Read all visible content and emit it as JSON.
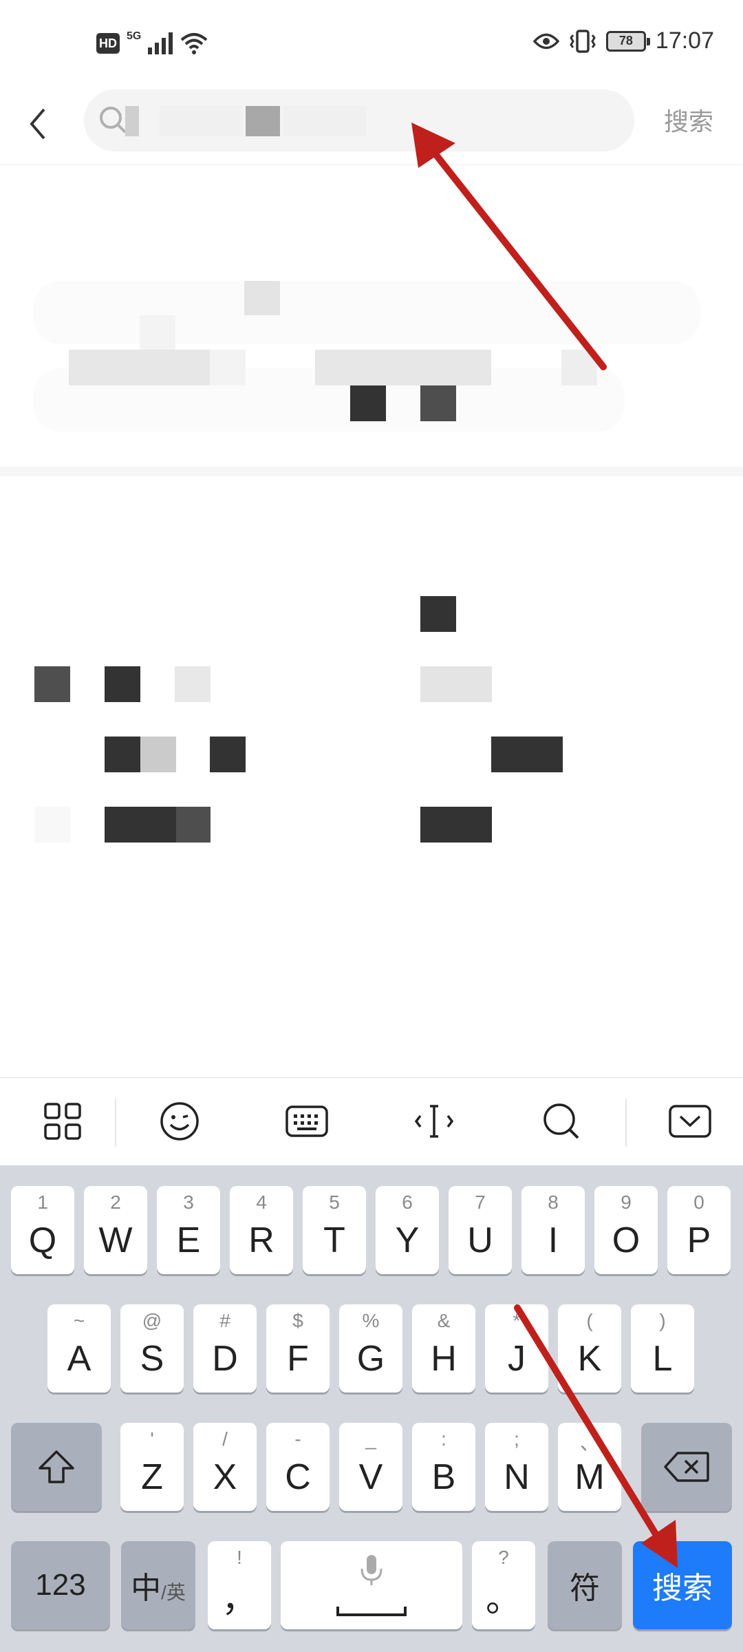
{
  "status_bar": {
    "hd": "HD",
    "network": "5G",
    "battery": "78",
    "time": "17:07"
  },
  "header": {
    "search_placeholder": "",
    "search_button": "搜索"
  },
  "toolbar": {
    "icons": [
      "apps-grid-icon",
      "emoji-icon",
      "keyboard-icon",
      "cursor-icon",
      "search-icon",
      "collapse-keyboard-icon"
    ]
  },
  "keyboard": {
    "row1": [
      {
        "hint": "1",
        "key": "Q"
      },
      {
        "hint": "2",
        "key": "W"
      },
      {
        "hint": "3",
        "key": "E"
      },
      {
        "hint": "4",
        "key": "R"
      },
      {
        "hint": "5",
        "key": "T"
      },
      {
        "hint": "6",
        "key": "Y"
      },
      {
        "hint": "7",
        "key": "U"
      },
      {
        "hint": "8",
        "key": "I"
      },
      {
        "hint": "9",
        "key": "O"
      },
      {
        "hint": "0",
        "key": "P"
      }
    ],
    "row2": [
      {
        "hint": "~",
        "key": "A"
      },
      {
        "hint": "@",
        "key": "S"
      },
      {
        "hint": "#",
        "key": "D"
      },
      {
        "hint": "$",
        "key": "F"
      },
      {
        "hint": "%",
        "key": "G"
      },
      {
        "hint": "&",
        "key": "H"
      },
      {
        "hint": "*",
        "key": "J"
      },
      {
        "hint": "(",
        "key": "K"
      },
      {
        "hint": ")",
        "key": "L"
      }
    ],
    "row3": [
      {
        "hint": "'",
        "key": "Z"
      },
      {
        "hint": "/",
        "key": "X"
      },
      {
        "hint": "-",
        "key": "C"
      },
      {
        "hint": "_",
        "key": "V"
      },
      {
        "hint": ":",
        "key": "B"
      },
      {
        "hint": ";",
        "key": "N"
      },
      {
        "hint": "、",
        "key": "M"
      }
    ],
    "num_key": "123",
    "lang_key_main": "中",
    "lang_key_sub": "/英",
    "comma_hint": "!",
    "comma_key": "，",
    "period_hint": "?",
    "period_key": "。",
    "symbol_key": "符",
    "search_key": "搜索"
  },
  "colors": {
    "accent_blue": "#1e7bfa",
    "arrow_red": "#c0201b",
    "keyboard_bg": "#d4d7de"
  }
}
